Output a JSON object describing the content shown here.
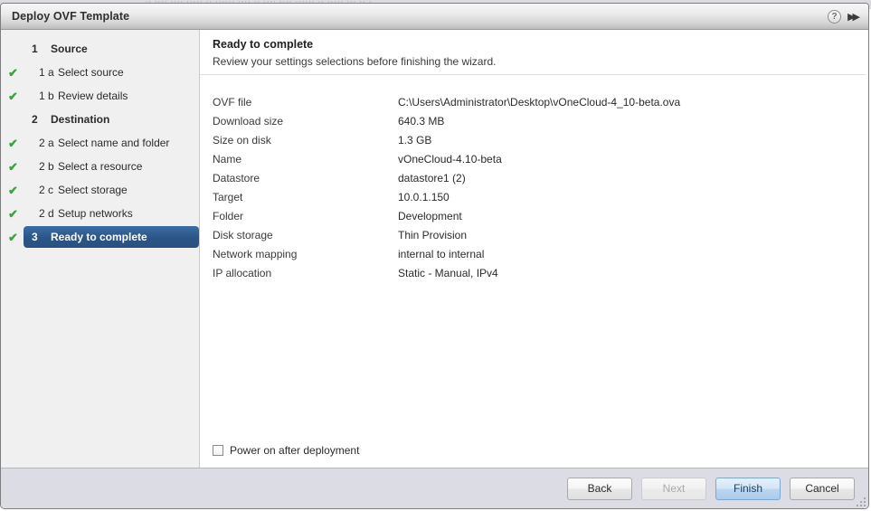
{
  "backdrop": {
    "ghost_text": "·· ···· ···· ····· ·· ······ ···· ·· ···· ···· ······ ·· ····· ··· ·· ·"
  },
  "window": {
    "title": "Deploy OVF Template",
    "help_icon": "help-circle-icon",
    "collapse_icon": "double-chevron-right-icon",
    "help_glyph": "?",
    "collapse_glyph": "▶▶"
  },
  "sidebar": {
    "check_glyph": "✔",
    "items": [
      {
        "num": "1",
        "label": "Source",
        "checked": false,
        "type": "group",
        "selected": false
      },
      {
        "num": "1 a",
        "label": "Select source",
        "checked": true,
        "type": "sub",
        "selected": false
      },
      {
        "num": "1 b",
        "label": "Review details",
        "checked": true,
        "type": "sub",
        "selected": false
      },
      {
        "num": "2",
        "label": "Destination",
        "checked": false,
        "type": "group",
        "selected": false
      },
      {
        "num": "2 a",
        "label": "Select name and folder",
        "checked": true,
        "type": "sub",
        "selected": false
      },
      {
        "num": "2 b",
        "label": "Select a resource",
        "checked": true,
        "type": "sub",
        "selected": false
      },
      {
        "num": "2 c",
        "label": "Select storage",
        "checked": true,
        "type": "sub",
        "selected": false
      },
      {
        "num": "2 d",
        "label": "Setup networks",
        "checked": true,
        "type": "sub",
        "selected": false
      },
      {
        "num": "3",
        "label": "Ready to complete",
        "checked": true,
        "type": "group",
        "selected": true
      }
    ]
  },
  "main": {
    "title": "Ready to complete",
    "subtitle": "Review your settings selections before finishing the wizard.",
    "summary": [
      {
        "label": "OVF file",
        "value": "C:\\Users\\Administrator\\Desktop\\vOneCloud-4_10-beta.ova"
      },
      {
        "label": "Download size",
        "value": "640.3 MB"
      },
      {
        "label": "Size on disk",
        "value": "1.3 GB"
      },
      {
        "label": "Name",
        "value": "vOneCloud-4.10-beta"
      },
      {
        "label": "Datastore",
        "value": "datastore1 (2)"
      },
      {
        "label": "Target",
        "value": "10.0.1.150"
      },
      {
        "label": "Folder",
        "value": "Development"
      },
      {
        "label": "Disk storage",
        "value": "Thin Provision"
      },
      {
        "label": "Network mapping",
        "value": "internal to internal"
      },
      {
        "label": "IP allocation",
        "value": "Static - Manual, IPv4"
      }
    ],
    "power_on_checkbox": {
      "label": "Power on after deployment",
      "checked": false
    }
  },
  "footer": {
    "buttons": [
      {
        "label": "Back",
        "state": "enabled"
      },
      {
        "label": "Next",
        "state": "disabled"
      },
      {
        "label": "Finish",
        "state": "primary"
      },
      {
        "label": "Cancel",
        "state": "enabled"
      }
    ]
  },
  "colors": {
    "accent_selected": "#2b5585",
    "check_green": "#34a834",
    "footer_bg": "#dcdce4",
    "sidebar_bg": "#f0f0f0",
    "primary_button": "#bbd6f0"
  }
}
